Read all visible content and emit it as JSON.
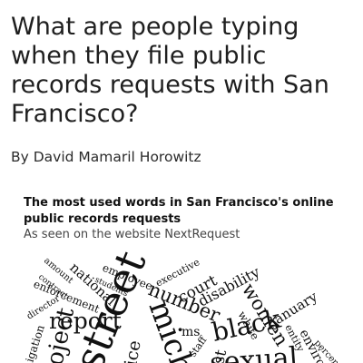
{
  "article": {
    "headline": "What are people typing when they file public records requests with San Francisco?",
    "byline": "By David Mamaril Horowitz"
  },
  "figure": {
    "title": "The most used words in San Francisco's online public records requests",
    "subtitle": "As seen on the website NextRequest",
    "words": [
      {
        "text": "amount"
      },
      {
        "text": "national"
      },
      {
        "text": "employee"
      },
      {
        "text": "executive"
      },
      {
        "text": "contract"
      },
      {
        "text": "students"
      },
      {
        "text": "enforcement"
      },
      {
        "text": "court"
      },
      {
        "text": "disability"
      },
      {
        "text": "number"
      },
      {
        "text": "women"
      },
      {
        "text": "director"
      },
      {
        "text": "report"
      },
      {
        "text": "street"
      },
      {
        "text": "mich"
      },
      {
        "text": "january"
      },
      {
        "text": "white"
      },
      {
        "text": "black"
      },
      {
        "text": "ms"
      },
      {
        "text": "entity"
      },
      {
        "text": "enviro"
      },
      {
        "text": "percent"
      },
      {
        "text": "igation"
      },
      {
        "text": "oject"
      },
      {
        "text": "ice"
      },
      {
        "text": "staff"
      },
      {
        "text": "st"
      },
      {
        "text": "sexual"
      }
    ]
  }
}
